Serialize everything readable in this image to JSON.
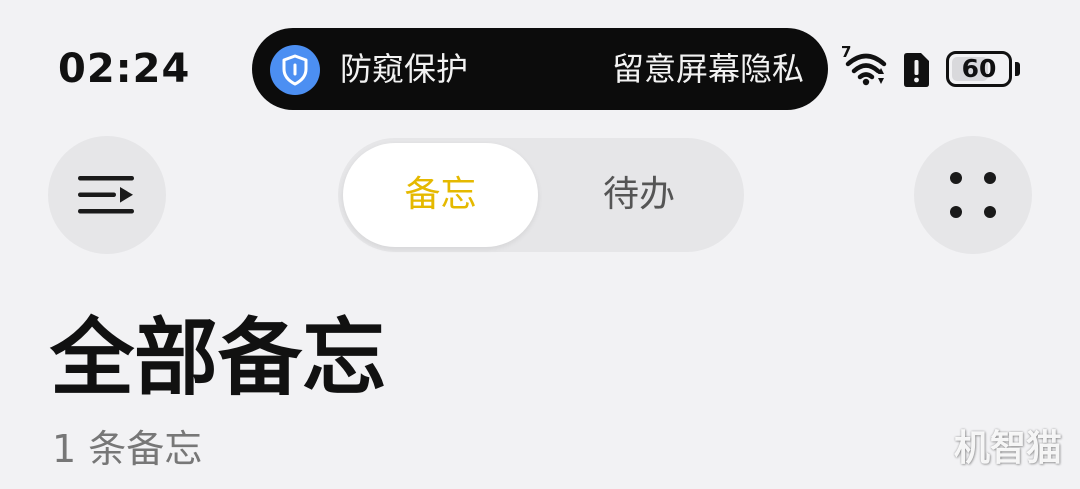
{
  "status_bar": {
    "time": "02:24",
    "island": {
      "left_text": "防窥保护",
      "right_text": "留意屏幕隐私",
      "icon": "shield-icon",
      "icon_color": "#4c8ff2"
    },
    "wifi": {
      "label": "7",
      "icon": "wifi-icon"
    },
    "sim_icon": "sim-alert-icon",
    "battery": {
      "level_text": "60",
      "level_fraction": 0.6
    }
  },
  "toolbar": {
    "menu_icon": "menu-collapse-icon",
    "more_icon": "four-dots-icon",
    "tabs": [
      {
        "label": "备忘",
        "active": true
      },
      {
        "label": "待办",
        "active": false
      }
    ],
    "accent_color": "#e5b900"
  },
  "main": {
    "title": "全部备忘",
    "count_text": "1 条备忘"
  },
  "watermark": "机智猫"
}
